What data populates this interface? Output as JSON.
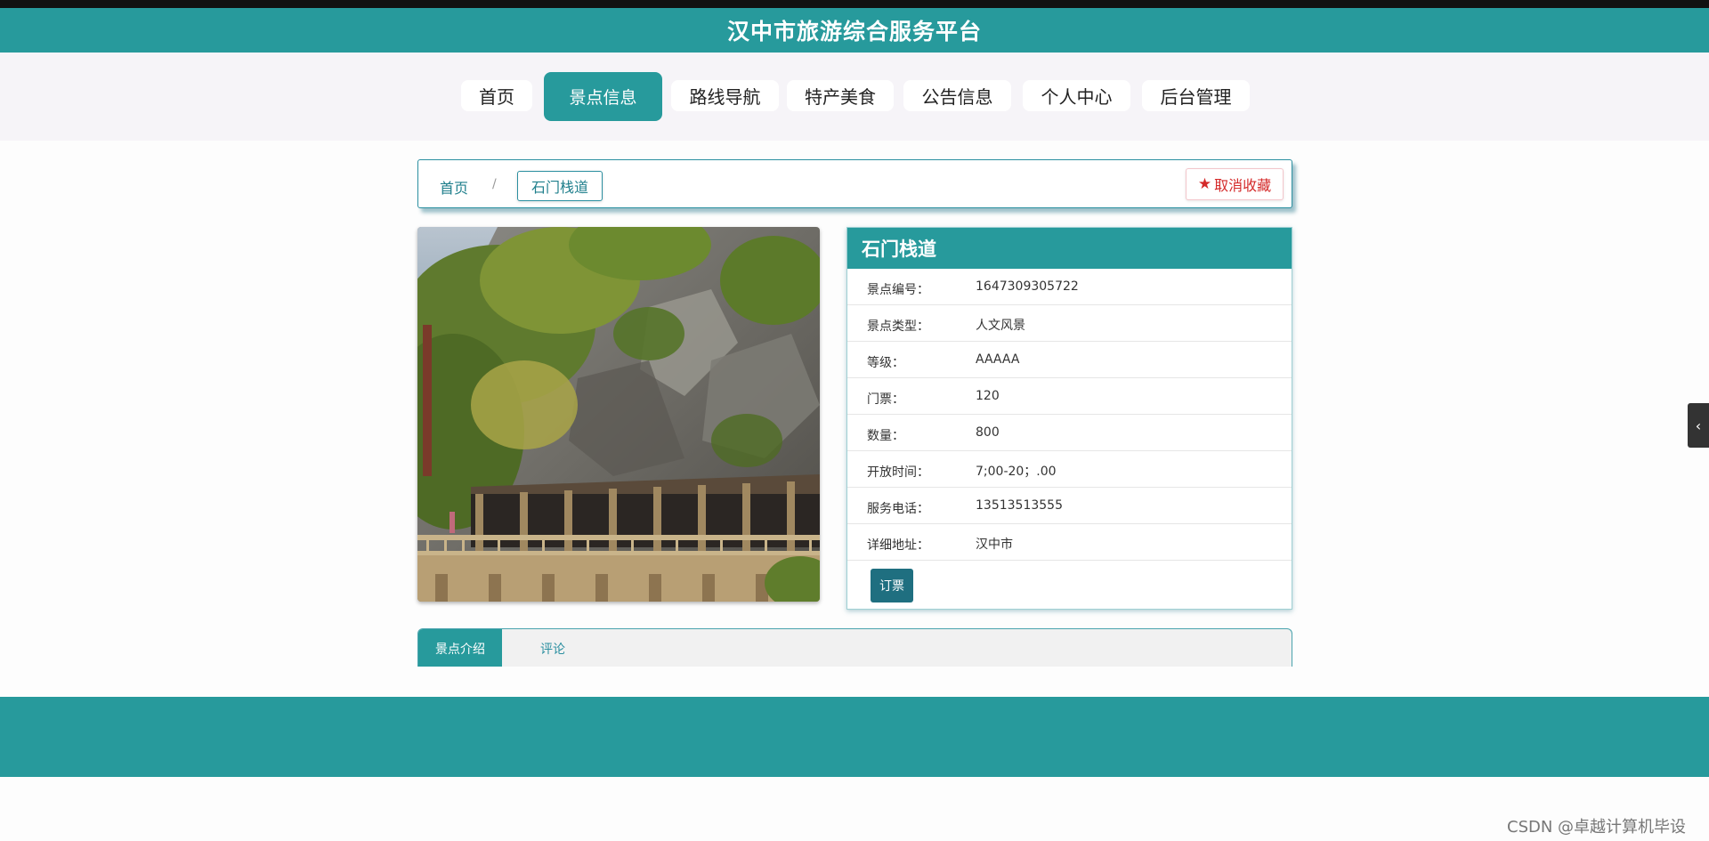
{
  "app": {
    "title": "汉中市旅游综合服务平台"
  },
  "nav": {
    "items": [
      {
        "label": "首页"
      },
      {
        "label": "景点信息",
        "active": true
      },
      {
        "label": "路线导航"
      },
      {
        "label": "特产美食"
      },
      {
        "label": "公告信息"
      },
      {
        "label": "个人中心"
      },
      {
        "label": "后台管理"
      }
    ]
  },
  "breadcrumb": {
    "home": "首页",
    "separator": "/",
    "current": "石门栈道"
  },
  "favorite": {
    "label": "取消收藏",
    "icon": "star-icon"
  },
  "attraction": {
    "name": "石门栈道",
    "fields": [
      {
        "label": "景点编号：",
        "value": "1647309305722"
      },
      {
        "label": "景点类型：",
        "value": "人文风景"
      },
      {
        "label": "等级：",
        "value": "AAAAA"
      },
      {
        "label": "门票：",
        "value": "120"
      },
      {
        "label": "数量：",
        "value": "800"
      },
      {
        "label": "开放时间：",
        "value": "7;00-20；.00"
      },
      {
        "label": "服务电话：",
        "value": "13513513555"
      },
      {
        "label": "详细地址：",
        "value": "汉中市"
      }
    ],
    "order_label": "订票"
  },
  "tabs": [
    {
      "label": "景点介绍",
      "active": true
    },
    {
      "label": "评论"
    }
  ],
  "side_toggle": {
    "icon": "chevron-left-icon",
    "glyph": "‹"
  },
  "watermark": "CSDN @卓越计算机毕设",
  "colors": {
    "primary": "#279a9c",
    "order_button": "#1f6f80",
    "favorite": "#d42a2a"
  }
}
